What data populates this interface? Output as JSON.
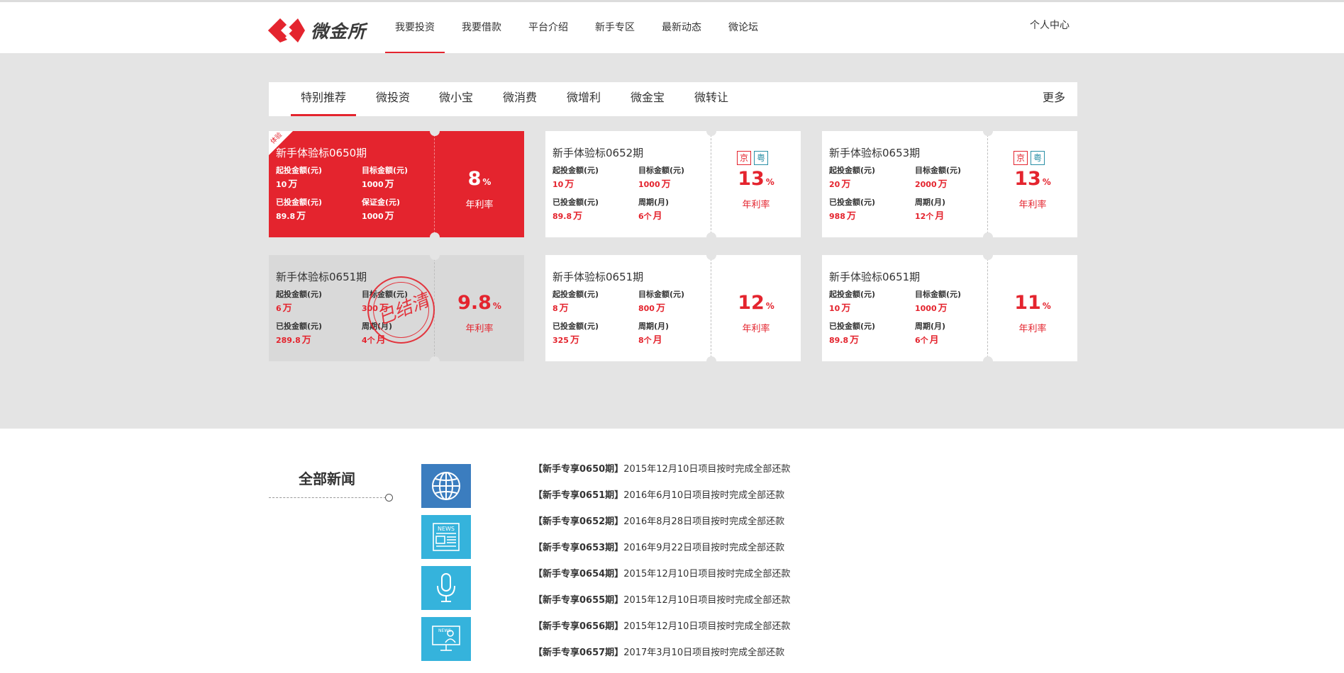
{
  "header": {
    "logo_text": "微金所",
    "nav": [
      "我要投资",
      "我要借款",
      "平台介绍",
      "新手专区",
      "最新动态",
      "微论坛"
    ],
    "user_center": "个人中心"
  },
  "tabs": {
    "items": [
      "特别推荐",
      "微投资",
      "微小宝",
      "微消费",
      "微增利",
      "微金宝",
      "微转让"
    ],
    "more": "更多"
  },
  "cards": [
    {
      "name": "新手体验标0650期",
      "corner": "体验",
      "f1": "起投金额(元)",
      "v1": "10",
      "u1": "万",
      "f2": "目标金额(元)",
      "v2": "1000",
      "u2": "万",
      "f3": "已投金额(元)",
      "v3": "89.8",
      "u3": "万",
      "f4": "保证金(元)",
      "v4": "1000",
      "u4": "万",
      "rate": "8",
      "pct": "%",
      "rate_label": "年利率"
    },
    {
      "name": "新手体验标0652期",
      "f1": "起投金额(元)",
      "v1": "10",
      "u1": "万",
      "f2": "目标金额(元)",
      "v2": "1000",
      "u2": "万",
      "f3": "已投金额(元)",
      "v3": "89.8",
      "u3": "万",
      "f4": "周期(月)",
      "v4": "6个",
      "u4": "月",
      "badge1": "京",
      "badge2": "粤",
      "rate": "13",
      "pct": "%",
      "rate_label": "年利率"
    },
    {
      "name": "新手体验标0653期",
      "f1": "起投金额(元)",
      "v1": "20",
      "u1": "万",
      "f2": "目标金额(元)",
      "v2": "2000",
      "u2": "万",
      "f3": "已投金额(元)",
      "v3": "988",
      "u3": "万",
      "f4": "周期(月)",
      "v4": "12个",
      "u4": "月",
      "badge1": "京",
      "badge2": "粤",
      "rate": "13",
      "pct": "%",
      "rate_label": "年利率"
    },
    {
      "name": "新手体验标0651期",
      "stamp": "已结清",
      "f1": "起投金额(元)",
      "v1": "6",
      "u1": "万",
      "f2": "目标金额(元)",
      "v2": "300",
      "u2": "万",
      "f3": "已投金额(元)",
      "v3": "289.8",
      "u3": "万",
      "f4": "周期(月)",
      "v4": "4个",
      "u4": "月",
      "rate": "9.8",
      "pct": "%",
      "rate_label": "年利率"
    },
    {
      "name": "新手体验标0651期",
      "f1": "起投金额(元)",
      "v1": "8",
      "u1": "万",
      "f2": "目标金额(元)",
      "v2": "800",
      "u2": "万",
      "f3": "已投金额(元)",
      "v3": "325",
      "u3": "万",
      "f4": "周期(月)",
      "v4": "8个",
      "u4": "月",
      "rate": "12",
      "pct": "%",
      "rate_label": "年利率"
    },
    {
      "name": "新手体验标0651期",
      "f1": "起投金额(元)",
      "v1": "10",
      "u1": "万",
      "f2": "目标金额(元)",
      "v2": "1000",
      "u2": "万",
      "f3": "已投金额(元)",
      "v3": "89.8",
      "u3": "万",
      "f4": "周期(月)",
      "v4": "6个",
      "u4": "月",
      "rate": "11",
      "pct": "%",
      "rate_label": "年利率"
    }
  ],
  "news": {
    "title": "全部新闻",
    "icons": [
      "globe-icon",
      "newspaper-icon",
      "microphone-icon",
      "news-screen-icon"
    ],
    "icon_label": "NEWS",
    "items": [
      {
        "tag": "【新手专享0650期】",
        "text": "2015年12月10日项目按时完成全部还款"
      },
      {
        "tag": "【新手专享0651期】",
        "text": "2016年6月10日项目按时完成全部还款"
      },
      {
        "tag": "【新手专享0652期】",
        "text": "2016年8月28日项目按时完成全部还款"
      },
      {
        "tag": "【新手专享0653期】",
        "text": "2016年9月22日项目按时完成全部还款"
      },
      {
        "tag": "【新手专享0654期】",
        "text": "2015年12月10日项目按时完成全部还款"
      },
      {
        "tag": "【新手专享0655期】",
        "text": "2015年12月10日项目按时完成全部还款"
      },
      {
        "tag": "【新手专享0656期】",
        "text": "2015年12月10日项目按时完成全部还款"
      },
      {
        "tag": "【新手专享0657期】",
        "text": "2017年3月10日项目按时完成全部还款"
      }
    ]
  },
  "colors": {
    "accent": "#e4242e",
    "gray_bg": "#e4e4e4",
    "news_icon_dark": "#3b7dbf",
    "news_icon_light": "#35b3dc",
    "badge_teal": "#2a8fa6"
  }
}
